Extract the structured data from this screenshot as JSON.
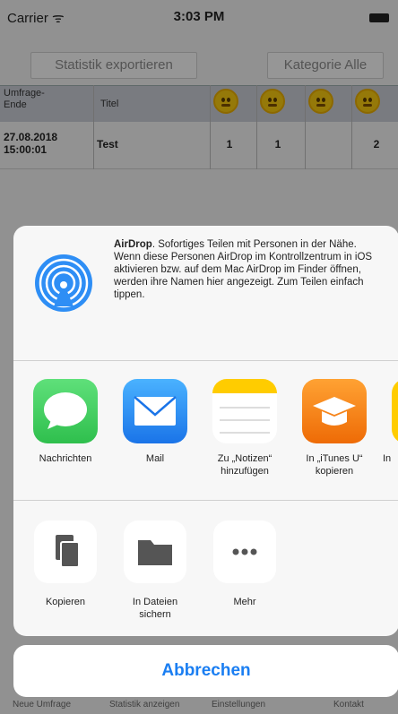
{
  "status_bar": {
    "carrier": "Carrier ᯤ",
    "time": "3:03 PM"
  },
  "toolbar": {
    "export_label": "Statistik exportieren",
    "category_label": "Kategorie Alle"
  },
  "table": {
    "col_end": "Umfrage-\nEnde",
    "col_title": "Titel",
    "row": {
      "date": "27.08.2018\n15:00:01",
      "title": "Test",
      "counts": [
        "1",
        "1",
        "",
        "2"
      ]
    }
  },
  "bottom_tabs": [
    "Neue Umfrage",
    "Statistik anzeigen",
    "Einstellungen",
    "Kontakt"
  ],
  "airdrop": {
    "title": "AirDrop",
    "text": ". Sofortiges Teilen mit Personen in der Nähe. Wenn diese Personen AirDrop im Kontrollzentrum in iOS aktivieren bzw. auf dem Mac AirDrop im Finder öffnen, werden ihre Namen hier angezeigt. Zum Teilen einfach tippen."
  },
  "apps": [
    {
      "label": "Nachrichten",
      "icon": "messages-icon",
      "color": "#34c759"
    },
    {
      "label": "Mail",
      "icon": "mail-icon",
      "color": "#1e88f0"
    },
    {
      "label": "Zu „Notizen“\nhinzufügen",
      "icon": "notes-icon",
      "color": "#ffcc00"
    },
    {
      "label": "In „iTunes U“\nkopieren",
      "icon": "itunes-u-icon",
      "color": "#f07a12"
    },
    {
      "label": "In",
      "icon": "more-app-icon",
      "color": "#ffcc00"
    }
  ],
  "actions": [
    {
      "label": "Kopieren",
      "icon": "copy-icon"
    },
    {
      "label": "In Dateien\nsichern",
      "icon": "folder-icon"
    },
    {
      "label": "Mehr",
      "icon": "more-dots-icon"
    }
  ],
  "cancel_label": "Abbrechen"
}
